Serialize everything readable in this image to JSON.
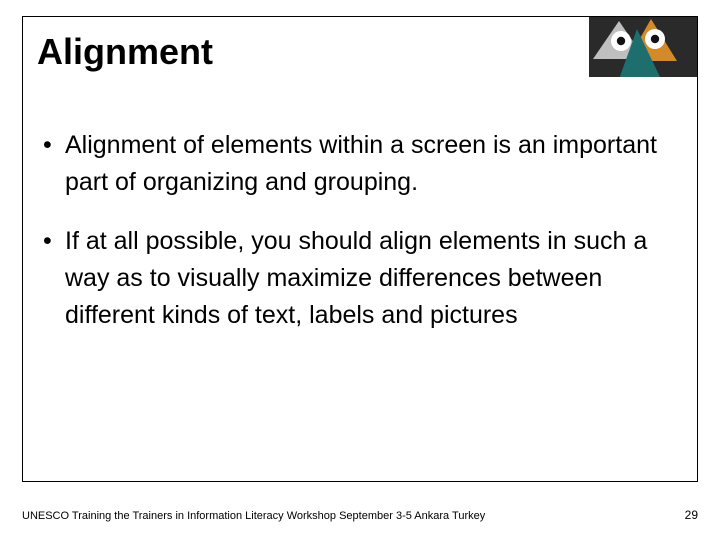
{
  "title": "Alignment",
  "bullets": [
    "Alignment of elements within a screen is an important part of organizing and grouping.",
    "If at all possible, you should align elements in such a way as to visually maximize differences between different kinds of text, labels and pictures"
  ],
  "footer": "UNESCO Training the Trainers in Information Literacy Workshop September 3-5 Ankara Turkey",
  "page_number": "29",
  "logo": {
    "name": "abstract-owl-logo",
    "colors": {
      "bg_dark": "#2a2a2a",
      "orange": "#d28a2a",
      "gray": "#bfbfbf",
      "teal": "#1e6e6e"
    }
  }
}
